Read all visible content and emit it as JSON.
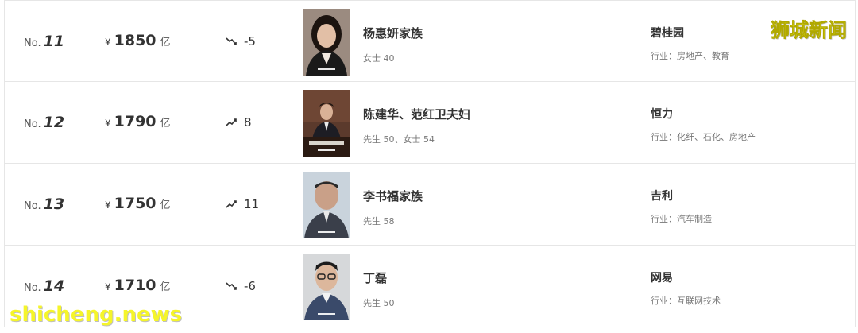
{
  "rows": [
    {
      "rank_prefix": "No.",
      "rank": "11",
      "currency": "¥",
      "amount": "1850",
      "unit": "亿",
      "trend": "down",
      "change": "-5",
      "name": "杨惠妍家族",
      "info": "女士  40",
      "company": "碧桂园",
      "industry": "行业：房地产、教育"
    },
    {
      "rank_prefix": "No.",
      "rank": "12",
      "currency": "¥",
      "amount": "1790",
      "unit": "亿",
      "trend": "up",
      "change": "8",
      "name": "陈建华、范红卫夫妇",
      "info": "先生  50、女士  54",
      "company": "恒力",
      "industry": "行业：化纤、石化、房地产"
    },
    {
      "rank_prefix": "No.",
      "rank": "13",
      "currency": "¥",
      "amount": "1750",
      "unit": "亿",
      "trend": "up",
      "change": "11",
      "name": "李书福家族",
      "info": "先生  58",
      "company": "吉利",
      "industry": "行业：汽车制造"
    },
    {
      "rank_prefix": "No.",
      "rank": "14",
      "currency": "¥",
      "amount": "1710",
      "unit": "亿",
      "trend": "down",
      "change": "-6",
      "name": "丁磊",
      "info": "先生  50",
      "company": "网易",
      "industry": "行业：互联网技术"
    }
  ],
  "watermark_top": "狮城新闻",
  "watermark_bottom": "shicheng.news",
  "colors": {
    "watermark": "#f5f52a",
    "border": "#e6e6e6"
  }
}
